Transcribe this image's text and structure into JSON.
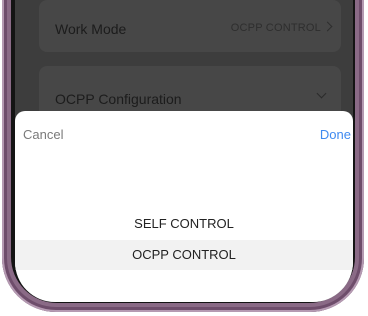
{
  "background_page": {
    "work_mode": {
      "label": "Work Mode",
      "value": "OCPP CONTROL",
      "icon": "chevron-right-icon"
    },
    "ocpp_configuration": {
      "label": "OCPP Configuration",
      "icon": "chevron-down-icon"
    }
  },
  "picker": {
    "cancel_label": "Cancel",
    "done_label": "Done",
    "options": [
      {
        "label": "SELF CONTROL",
        "selected": false
      },
      {
        "label": "OCPP CONTROL",
        "selected": true
      }
    ]
  },
  "colors": {
    "done_accent": "#3f8af0",
    "selected_row": "#f2f2f2",
    "frame": "#8a6a86"
  }
}
